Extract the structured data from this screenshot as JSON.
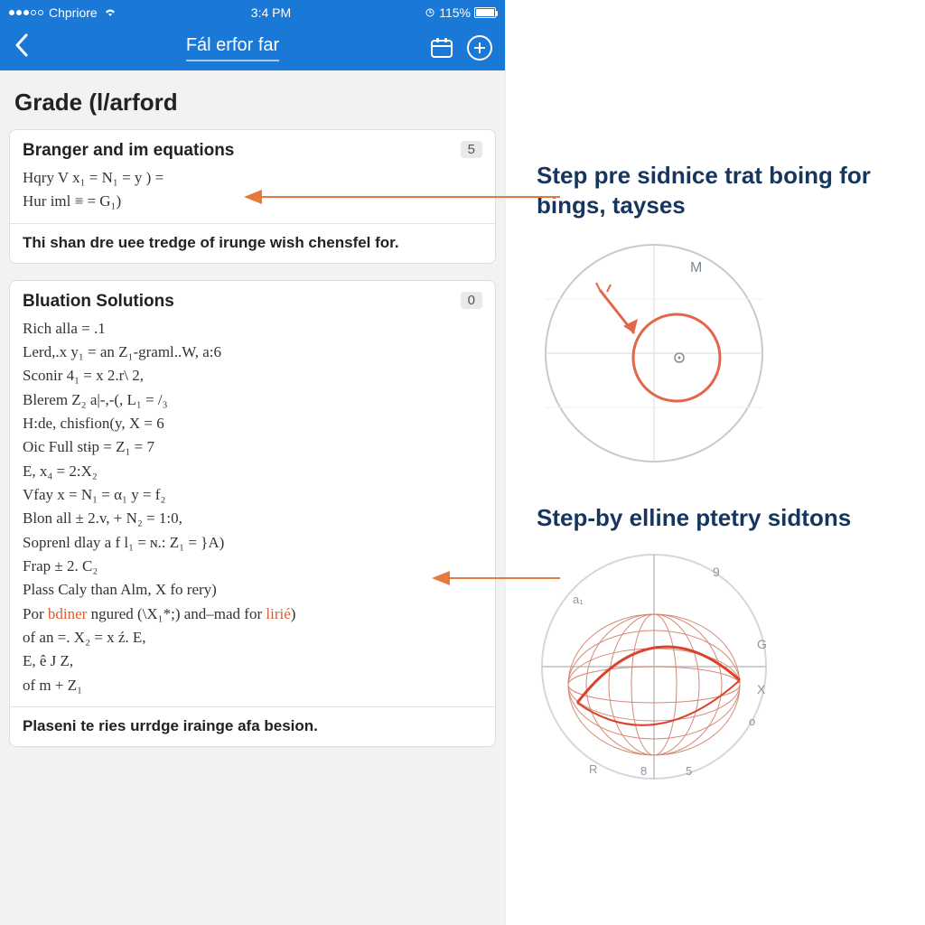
{
  "status": {
    "carrier": "Chpriore",
    "time": "3:4 PM",
    "battery_pct": "115%"
  },
  "nav": {
    "title": "Fál erfor far"
  },
  "page": {
    "title": "Grade  (l/arford"
  },
  "card1": {
    "title": "Branger and im equations",
    "badge": "5",
    "line1": "Hqry V x₁ = N₁ =  y ) =",
    "line2": "Hur iml ≡ = G₁)",
    "footer": "Thi shan dre uee tredge of irunge wish chensfel for."
  },
  "card2": {
    "title": "Bluation Solutions",
    "badge": "0",
    "lines": [
      "Rich alla = .1",
      "Lerd,.x  y₁ = an  Z₁-graml..W, a:6",
      "Sconir 4₁ = x  2.r\\ 2,",
      "Blerem Z₂ a|-,-(,  L₁ = /₃",
      "H:de, chisfion(y,  X = 6",
      "Oic Full  stɨp =   Z₁ = 7",
      "E, x₄ = 2:X₂",
      "Vfay x = N₁ = α₁ y = f₂",
      "Blon all ± 2.v, + N₂ = 1:0,",
      "Soprenl dlay a f l₁ = ɴ.: Z₁ = }A)",
      "Frap ± 2. C₂",
      "Plass Caly than Alm, X  fo rery)",
      "Por bdiner ngured (\\X₁*;) and–mad for lirie)",
      "of an =. X₂ = x  ź. E,",
      "E, ê  J Z,",
      "of m + Z₁"
    ],
    "footer": "Plaseni te ries urrdge irainge afa besion."
  },
  "callouts": {
    "c1": "Step pre sidnice trat boing for bings, tayses",
    "c2": "Step-by elline ptetry sidtons"
  },
  "diagram_labels": {
    "top_M": "M",
    "d2_9": "9",
    "d2_G": "G",
    "d2_X": "X",
    "d2_o": "o",
    "d2_5": "5",
    "d2_8": "8",
    "d2_R": "R",
    "d2_a": "a₁"
  },
  "colors": {
    "brand": "#1a78d6",
    "accent": "#e05a2b",
    "heading": "#16365f"
  }
}
